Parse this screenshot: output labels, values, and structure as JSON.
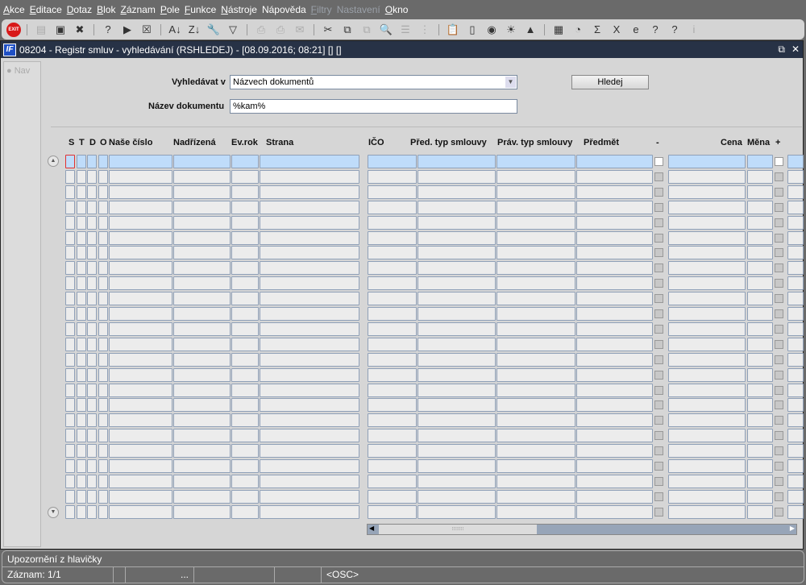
{
  "menu": [
    {
      "label": "Akce",
      "u": "A",
      "enabled": true
    },
    {
      "label": "Editace",
      "u": "E",
      "enabled": true
    },
    {
      "label": "Dotaz",
      "u": "D",
      "enabled": true
    },
    {
      "label": "Blok",
      "u": "B",
      "enabled": true
    },
    {
      "label": "Záznam",
      "u": "Z",
      "enabled": true
    },
    {
      "label": "Pole",
      "u": "P",
      "enabled": true
    },
    {
      "label": "Funkce",
      "u": "F",
      "enabled": true
    },
    {
      "label": "Nástroje",
      "u": "N",
      "enabled": true
    },
    {
      "label": "Nápověda",
      "u": "o",
      "enabled": true
    },
    {
      "label": "Filtry",
      "u": "F",
      "enabled": false
    },
    {
      "label": "Nastavení",
      "u": "s",
      "enabled": false
    },
    {
      "label": "Okno",
      "u": "O",
      "enabled": true
    }
  ],
  "toolbar": {
    "exit_label": "EXIT",
    "icons": [
      {
        "name": "exit-icon",
        "glyph": "EXIT",
        "cls": "exit"
      },
      {
        "sep": true
      },
      {
        "name": "insert-record-icon",
        "glyph": "▤",
        "cls": "dis"
      },
      {
        "name": "save-record-icon",
        "glyph": "▣",
        "cls": ""
      },
      {
        "name": "delete-record-icon",
        "glyph": "✖",
        "cls": ""
      },
      {
        "sep": true
      },
      {
        "name": "enter-query-icon",
        "glyph": "?",
        "cls": ""
      },
      {
        "name": "execute-query-icon",
        "glyph": "▶",
        "cls": ""
      },
      {
        "name": "cancel-query-icon",
        "glyph": "☒",
        "cls": ""
      },
      {
        "sep": true
      },
      {
        "name": "sort-asc-icon",
        "glyph": "A↓",
        "cls": ""
      },
      {
        "name": "sort-desc-icon",
        "glyph": "Z↓",
        "cls": ""
      },
      {
        "name": "wrench-icon",
        "glyph": "🔧",
        "cls": "dis"
      },
      {
        "name": "filter-icon",
        "glyph": "▽",
        "cls": ""
      },
      {
        "sep": true
      },
      {
        "name": "print-icon",
        "glyph": "⎙",
        "cls": "dis"
      },
      {
        "name": "print-multi-icon",
        "glyph": "⎙",
        "cls": "dis"
      },
      {
        "name": "mail-icon",
        "glyph": "✉",
        "cls": "dis"
      },
      {
        "sep": true
      },
      {
        "name": "cut-icon",
        "glyph": "✂",
        "cls": ""
      },
      {
        "name": "copy-icon",
        "glyph": "⧉",
        "cls": ""
      },
      {
        "name": "paste-icon",
        "glyph": "⧉",
        "cls": "dis"
      },
      {
        "name": "zoom-icon",
        "glyph": "🔍",
        "cls": ""
      },
      {
        "name": "list-icon",
        "glyph": "☰",
        "cls": "dis"
      },
      {
        "name": "tree-icon",
        "glyph": "⋮",
        "cls": "dis"
      },
      {
        "sep": true
      },
      {
        "name": "clipboard-icon",
        "glyph": "📋",
        "cls": ""
      },
      {
        "name": "document-icon",
        "glyph": "▯",
        "cls": ""
      },
      {
        "name": "globe-icon",
        "glyph": "◉",
        "cls": ""
      },
      {
        "name": "sun-icon",
        "glyph": "☀",
        "cls": ""
      },
      {
        "name": "triangle-icon",
        "glyph": "▲",
        "cls": ""
      },
      {
        "sep": true
      },
      {
        "name": "report-icon",
        "glyph": "▦",
        "cls": ""
      },
      {
        "name": "chart-icon",
        "glyph": "◔",
        "cls": ""
      },
      {
        "name": "sum-icon",
        "glyph": "Σ",
        "cls": ""
      },
      {
        "name": "excel-icon",
        "glyph": "X",
        "cls": ""
      },
      {
        "name": "ie-icon",
        "glyph": "e",
        "cls": ""
      },
      {
        "name": "help-topic-icon",
        "glyph": "?",
        "cls": ""
      },
      {
        "name": "help-icon",
        "glyph": "?",
        "cls": ""
      },
      {
        "name": "info-icon",
        "glyph": "i",
        "cls": "dis"
      }
    ]
  },
  "window": {
    "title": "08204 - Registr smluv - vyhledávání (RSHLEDEJ) - [08.09.2016; 08:21] [] []",
    "logo": "IF",
    "restore": "⧉",
    "close": "✕"
  },
  "nav": {
    "label": "Nav"
  },
  "search": {
    "label_in": "Vyhledávat v",
    "in_value": "Názvech dokumentů",
    "label_name": "Název dokumentu",
    "name_value": "%kam%",
    "button": "Hledej"
  },
  "grid": {
    "headers": [
      "S",
      "T",
      "D",
      "O",
      "Naše číslo",
      "Nadřízená",
      "Ev.rok",
      "Strana",
      "IČO",
      "Před. typ smlouvy",
      "Práv. typ smlouvy",
      "Předmět",
      "-",
      "Cena",
      "Měna",
      "+"
    ]
  },
  "status": {
    "message": "Upozornění z hlavičky",
    "record": "Záznam: 1/1",
    "ellipsis": "...",
    "mode": "<OSC>"
  }
}
